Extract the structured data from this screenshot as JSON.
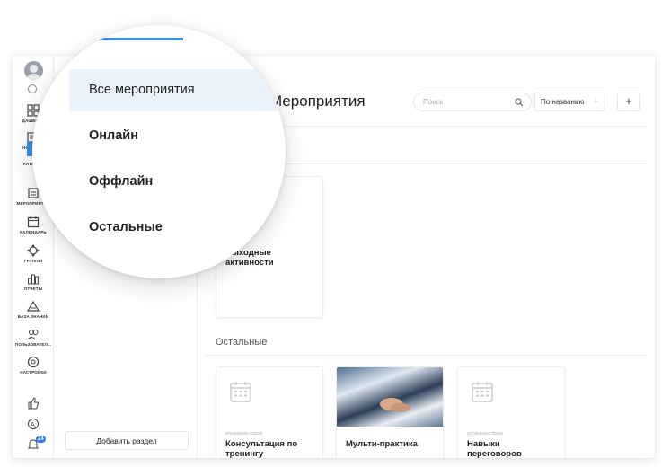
{
  "rail": {
    "items": [
      {
        "label": "ДАШБОРД",
        "icon": "dashboard-icon"
      },
      {
        "label": "НОВОСТИ",
        "icon": "news-icon"
      },
      {
        "label": "КАТАЛОГ",
        "icon": "catalog-icon"
      },
      {
        "label": "МЕРОПРИЯТИЯ",
        "icon": "events-icon"
      },
      {
        "label": "КАЛЕНДАРЬ",
        "icon": "calendar-icon"
      },
      {
        "label": "ГРУППЫ",
        "icon": "groups-icon"
      },
      {
        "label": "ОТЧЕТЫ",
        "icon": "reports-icon"
      },
      {
        "label": "БАЗА ЗНАНИЙ",
        "icon": "knowledge-base-icon"
      },
      {
        "label": "ПОЛЬЗОВАТЕЛ...",
        "icon": "users-icon"
      },
      {
        "label": "НАСТРОЙКИ",
        "icon": "settings-icon"
      }
    ],
    "notifications_count": "24"
  },
  "panel2": {
    "add_section_label": "Добавить раздел"
  },
  "header": {
    "title": "Мероприятия",
    "search_placeholder": "Поиск",
    "sort_value": "По названию",
    "add_label": "+"
  },
  "magnifier": {
    "items": [
      "Все мероприятия",
      "Онлайн",
      "Оффлайн",
      "Остальные"
    ],
    "active_index": 0
  },
  "cards_top": [
    {
      "title_line1": "Выходные",
      "title_line2": "активности"
    }
  ],
  "section_other": "Остальные",
  "cards_bottom": [
    {
      "code": "0724660636-235235",
      "title_line1": "Консультация по",
      "title_line2": "тренингу"
    },
    {
      "code": "",
      "title_line1": "Мульти-практика",
      "title_line2": ""
    },
    {
      "code": "0273fe002e17f0236",
      "title_line1": "Навыки",
      "title_line2": "переговоров"
    }
  ],
  "colors": {
    "accent": "#3a8ee8",
    "active_bg": "#eaf2fb",
    "border": "#eceef1"
  }
}
